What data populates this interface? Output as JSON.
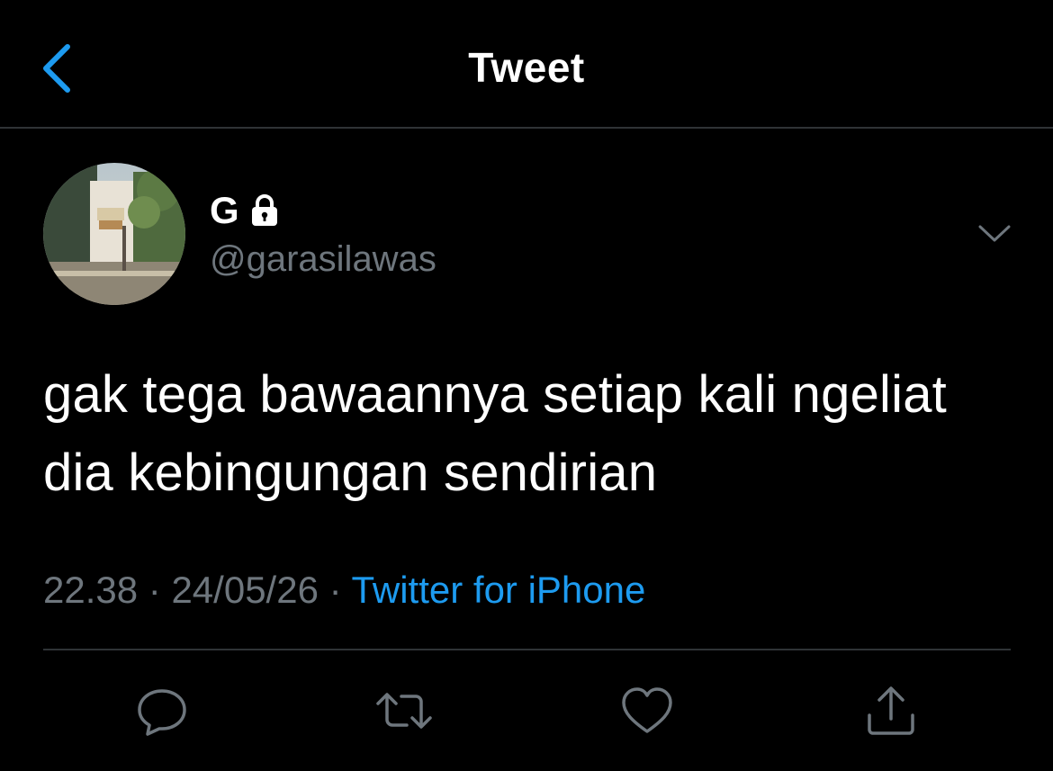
{
  "header": {
    "title": "Tweet",
    "back_icon": "chevron-left-icon"
  },
  "author": {
    "name": "G",
    "handle": "@garasilawas",
    "protected_icon": "lock-icon",
    "menu_icon": "chevron-down-icon"
  },
  "tweet": {
    "text": "gak tega bawaannya setiap kali ngeliat dia kebingungan sendirian",
    "time": "22.38",
    "date": "24/05/26",
    "separator": "·",
    "source": "Twitter for iPhone"
  },
  "actions": [
    {
      "icon": "reply-icon"
    },
    {
      "icon": "retweet-icon"
    },
    {
      "icon": "like-icon"
    },
    {
      "icon": "share-icon"
    }
  ],
  "colors": {
    "background": "#000000",
    "accent": "#1d9bf0",
    "secondary_text": "#6e767d",
    "divider": "#2f3336"
  }
}
